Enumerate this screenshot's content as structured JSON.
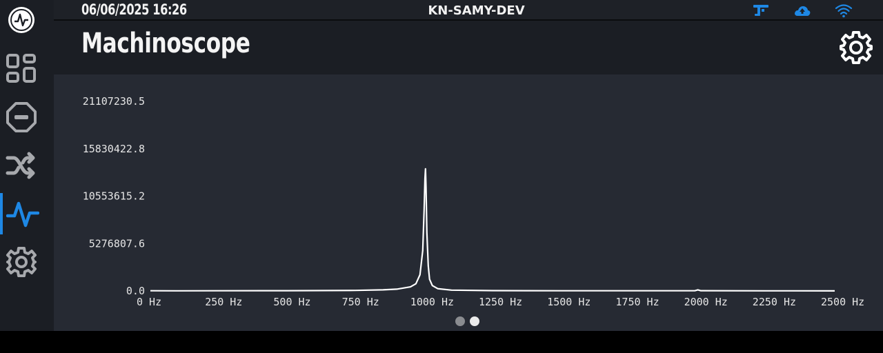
{
  "status": {
    "datetime": "06/06/2025 16:26",
    "device_name": "KN-SAMY-DEV",
    "icons": [
      "network-usage-icon",
      "cloud-upload-icon",
      "wifi-icon"
    ],
    "icon_color": "#1e88e5"
  },
  "header": {
    "title": "Machinoscope"
  },
  "sidebar": {
    "items": [
      {
        "name": "dashboard",
        "icon": "grid-icon",
        "active": false
      },
      {
        "name": "stop",
        "icon": "stop-octagon-icon",
        "active": false
      },
      {
        "name": "shuffle",
        "icon": "shuffle-icon",
        "active": false
      },
      {
        "name": "machinoscope",
        "icon": "pulse-icon",
        "active": true
      },
      {
        "name": "settings",
        "icon": "gear-icon",
        "active": false
      }
    ],
    "active_color": "#1e88e5"
  },
  "pager": {
    "pages": 2,
    "current": 2
  },
  "chart_data": {
    "type": "line",
    "title": "",
    "xlabel": "",
    "ylabel": "",
    "xlim": [
      0,
      2500
    ],
    "ylim": [
      0,
      21107230.5
    ],
    "x_ticks": [
      "0 Hz",
      "250 Hz",
      "500 Hz",
      "750 Hz",
      "1000 Hz",
      "1250 Hz",
      "1500 Hz",
      "1750 Hz",
      "2000 Hz",
      "2250 Hz",
      "2500 Hz"
    ],
    "y_ticks": [
      "0.0",
      "5276807.6",
      "10553615.2",
      "15830422.8",
      "21107230.5"
    ],
    "grid": false,
    "series": [
      {
        "color": "#ffffff",
        "x": [
          0,
          100,
          250,
          500,
          750,
          850,
          900,
          950,
          970,
          985,
          995,
          1000,
          1003,
          1005,
          1007,
          1010,
          1015,
          1020,
          1030,
          1050,
          1100,
          1250,
          1500,
          1750,
          1990,
          2000,
          2010,
          2250,
          2500
        ],
        "y": [
          25000,
          15000,
          20000,
          30000,
          60000,
          120000,
          200000,
          450000,
          800000,
          1800000,
          4500000,
          9000000,
          12500000,
          13600000,
          11500000,
          6500000,
          2800000,
          1300000,
          600000,
          250000,
          90000,
          40000,
          25000,
          20000,
          30000,
          120000,
          30000,
          15000,
          10000
        ]
      }
    ]
  }
}
